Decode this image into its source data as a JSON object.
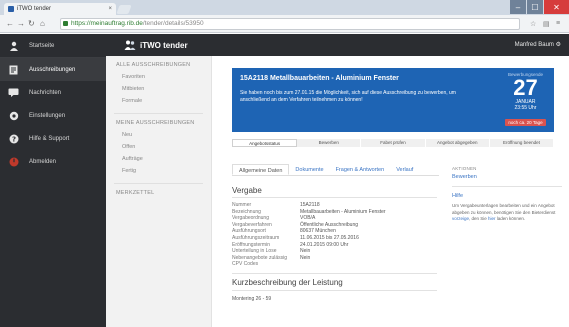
{
  "browser": {
    "tab_title": "iTWO tender",
    "url_domain": "https://meinauftrag.rib.de",
    "url_path": "/tender/details/53950",
    "win_min": "–",
    "win_max": "☐",
    "win_close": "✕"
  },
  "sidebar": {
    "items": [
      {
        "label": "Startseite",
        "icon": "user-icon"
      },
      {
        "label": "Ausschreibungen",
        "icon": "document-icon"
      },
      {
        "label": "Nachrichten",
        "icon": "message-icon"
      },
      {
        "label": "Einstellungen",
        "icon": "gear-icon"
      },
      {
        "label": "Hilfe & Support",
        "icon": "help-icon"
      },
      {
        "label": "Abmelden",
        "icon": "power-icon"
      }
    ]
  },
  "header": {
    "brand": "iTWO tender",
    "user": "Manfred Baum"
  },
  "subnav": {
    "section1": "ALLE AUSSCHREIBUNGEN",
    "section1_links": [
      "Favoriten",
      "Mitbieten",
      "Formale"
    ],
    "section2": "MEINE AUSSCHREIBUNGEN",
    "section2_links": [
      "Neu",
      "Offen",
      "Aufträge",
      "Fertig"
    ],
    "section3": "MERKZETTEL"
  },
  "banner": {
    "title": "15A2118 Metallbauarbeiten - Aluminium Fenster",
    "description": "Sie haben noch bis zum 27.01.15 die Möglichkeit, sich auf diese Ausschreibung zu bewerben, um anschließend an dem Verfahren teilnehmen zu können!",
    "deadline_label": "Bewerbungsende",
    "day": "27",
    "month": "JANUAR",
    "time": "23:55 Uhr",
    "badge": "noch ca. 20 Tage",
    "color": "#1e64b4"
  },
  "steps": [
    "Angebotsstatus",
    "Bewerben",
    "Fabet prüfen",
    "Angebot abgegeben",
    "Eröffnung beendet"
  ],
  "tabs": [
    "Allgemeine Daten",
    "Dokumente",
    "Fragen & Antworten",
    "Verlauf"
  ],
  "vergabe": {
    "title": "Vergabe",
    "rows": [
      {
        "k": "Nummer",
        "v": "15A2118"
      },
      {
        "k": "Bezeichnung",
        "v": "Metallbauarbeiten - Aluminium Fenster"
      },
      {
        "k": "Vergabeordnung",
        "v": "VOB/A"
      },
      {
        "k": "Vergabeverfahren",
        "v": "Öffentliche Ausschreibung"
      },
      {
        "k": "Ausführungsort",
        "v": "80637 München"
      },
      {
        "k": "Ausführungszeitraum",
        "v": "11.06.2015 bis 27.05.2016"
      },
      {
        "k": "Eröffnungstermin",
        "v": "24.01.2015 09:00 Uhr"
      },
      {
        "k": "Unterteilung in Lose",
        "v": "Nein"
      },
      {
        "k": "Nebenangebote zulässig",
        "v": "Nein"
      },
      {
        "k": "CPV Codes",
        "v": ""
      }
    ]
  },
  "kurz": {
    "title": "Kurzbeschreibung der Leistung",
    "line": "Montering 26 - 59"
  },
  "right_panel": {
    "label": "AKTIONEN",
    "action": "Bewerben",
    "help_label": "Hilfe",
    "help_text_1": "Um Vergabeunterlagen bearbeiten und ein Angebot abgeben zu können, benötigen Sie den Bieterdienst ",
    "help_link": "vorzeige",
    "help_text_2": ", den Sie ",
    "help_link2": "hier",
    "help_text_3": " laden können."
  }
}
